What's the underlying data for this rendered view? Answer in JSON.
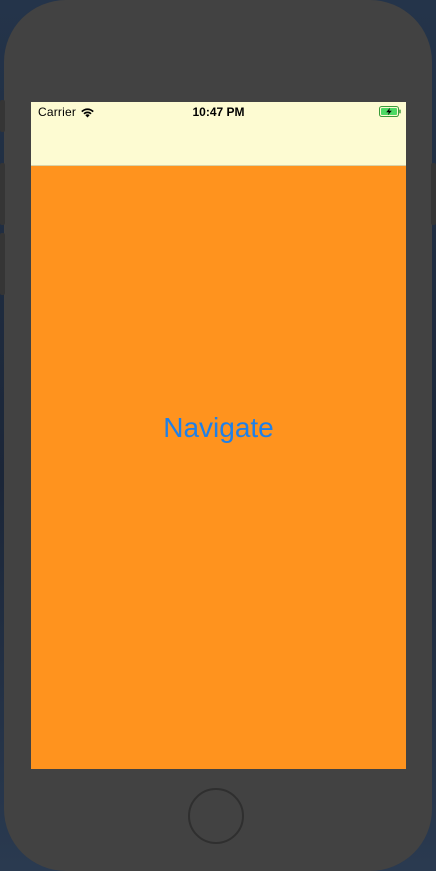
{
  "status_bar": {
    "carrier": "Carrier",
    "time": "10:47 PM",
    "wifi_icon": "wifi-icon",
    "battery_icon": "battery-charging-icon"
  },
  "nav_bar": {
    "background_color": "#fdfbd2"
  },
  "main": {
    "background_color": "#ff931e",
    "navigate_label": "Navigate",
    "navigate_color": "#1f80e8"
  },
  "device": {
    "home_button_icon": "home-button"
  }
}
